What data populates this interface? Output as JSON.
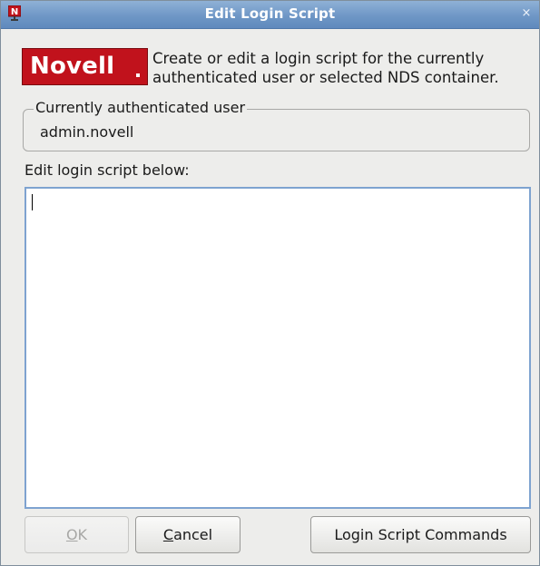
{
  "window": {
    "title": "Edit Login Script",
    "close_glyph": "×",
    "app_icon": "novell-n-icon"
  },
  "header": {
    "logo_text": "Novell",
    "description_line1": "Create or edit a login script for the currently",
    "description_line2": "authenticated user or selected NDS container."
  },
  "user_group": {
    "legend": "Currently authenticated user",
    "value": "admin.novell"
  },
  "editor": {
    "label": "Edit login script below:",
    "content": ""
  },
  "buttons": {
    "ok_mnemonic": "O",
    "ok_rest": "K",
    "ok_enabled": false,
    "cancel_mnemonic": "C",
    "cancel_rest": "ancel",
    "commands_label": "Login Script Commands"
  },
  "colors": {
    "titlebar": "#6f97c6",
    "logo_red": "#c1121c",
    "window_bg": "#ededeb",
    "editor_border": "#7ea3d0"
  }
}
